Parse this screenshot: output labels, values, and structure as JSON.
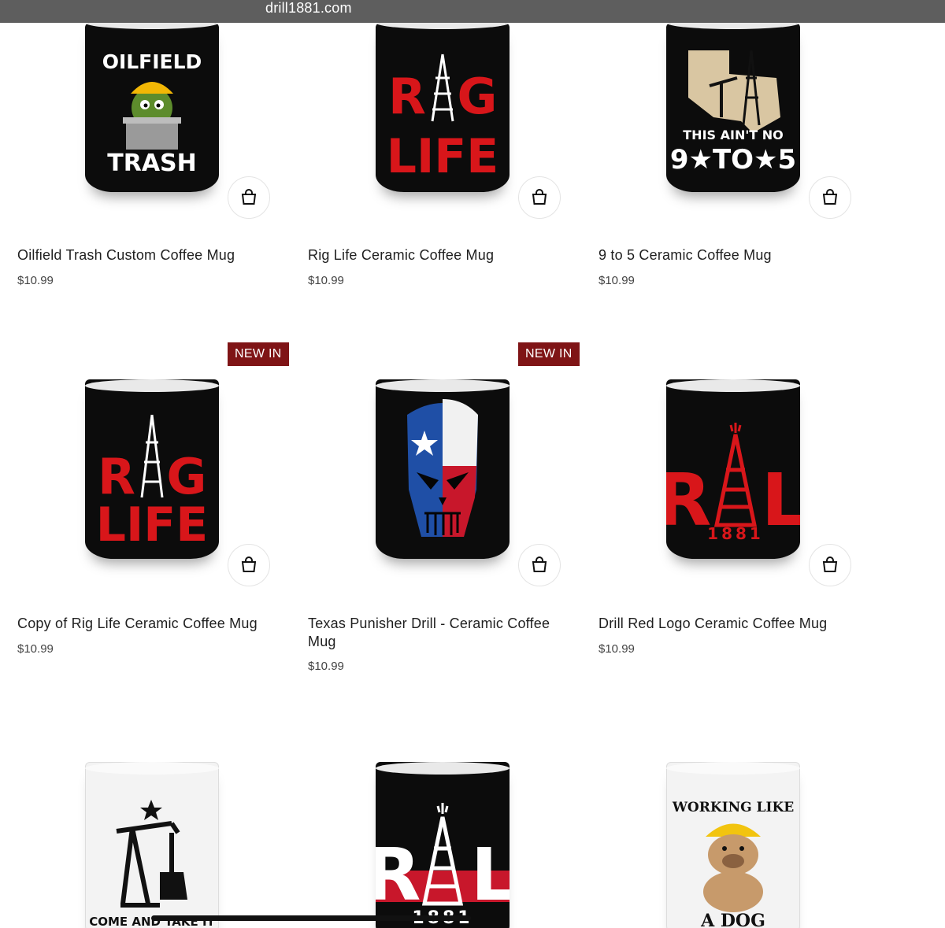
{
  "browser": {
    "url": "drill1881.com"
  },
  "colors": {
    "badge": "#7f1416",
    "accent_red": "#d8161a"
  },
  "products": [
    {
      "title": "Oilfield Trash Custom Coffee Mug",
      "price": "$10.99",
      "art_text": [
        "OILFIELD",
        "TRASH"
      ]
    },
    {
      "title": "Rig Life Ceramic Coffee Mug",
      "price": "$10.99",
      "art_text": [
        "R",
        "G",
        "LIFE"
      ]
    },
    {
      "title": "9 to 5 Ceramic Coffee Mug",
      "price": "$10.99",
      "art_text": [
        "THIS AIN'T NO",
        "9★TO★5"
      ]
    },
    {
      "title": "Copy of Rig Life Ceramic Coffee Mug",
      "price": "$10.99",
      "badge": "NEW IN",
      "art_text": [
        "R",
        "G",
        "LIFE"
      ]
    },
    {
      "title": "Texas Punisher Drill - Ceramic Coffee Mug",
      "price": "$10.99",
      "badge": "NEW IN"
    },
    {
      "title": "Drill Red Logo Ceramic Coffee Mug",
      "price": "$10.99",
      "art_text": [
        "R",
        "L",
        "1881"
      ]
    },
    {
      "art_text": [
        "COME AND TAKE IT"
      ]
    },
    {
      "art_text": [
        "R",
        "L",
        "1881"
      ]
    },
    {
      "art_text": [
        "WORKING LIKE",
        "A DOG"
      ]
    }
  ]
}
